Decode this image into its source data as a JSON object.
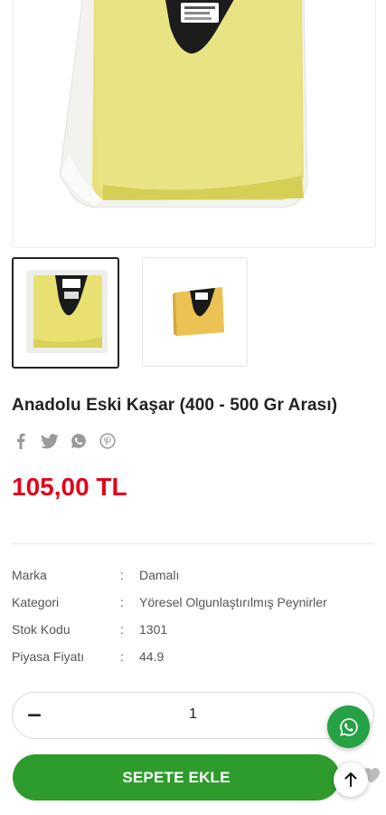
{
  "product": {
    "title": "Anadolu Eski Kaşar (400 - 500 Gr Arası)",
    "price": "105,00 TL"
  },
  "share_icons": [
    "facebook-icon",
    "twitter-icon",
    "whatsapp-icon",
    "pinterest-icon"
  ],
  "specs": [
    {
      "label": "Marka",
      "sep": ":",
      "value": "Damalı"
    },
    {
      "label": "Kategori",
      "sep": ":",
      "value": "Yöresel Olgunlaştırılmış Peynirler"
    },
    {
      "label": "Stok Kodu",
      "sep": ":",
      "value": "1301"
    },
    {
      "label": "Piyasa Fiyatı",
      "sep": ":",
      "value": "44.9"
    }
  ],
  "quantity": {
    "value": "1"
  },
  "cart_button": {
    "label": "SEPETE EKLE"
  },
  "colors": {
    "price": "#e1061a",
    "cart_button": "#2e9c2c",
    "whatsapp": "#25a244"
  }
}
